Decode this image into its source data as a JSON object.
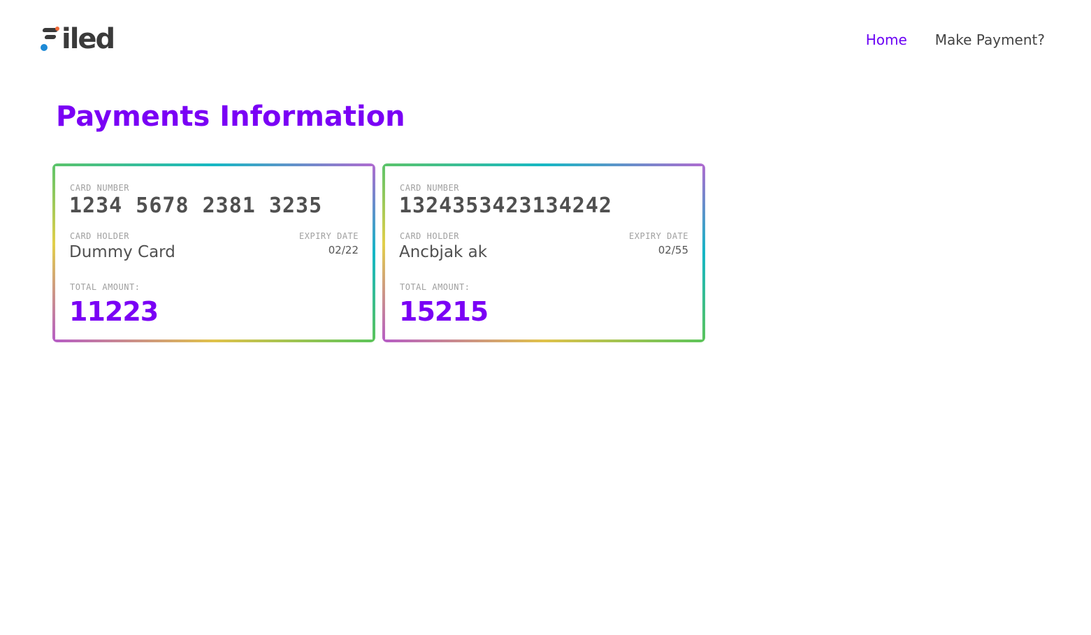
{
  "header": {
    "logo_text": "iled",
    "nav": {
      "home_label": "Home",
      "make_payment_label": "Make Payment?"
    }
  },
  "main": {
    "title": "Payments Information",
    "cards": [
      {
        "card_number_label": "CARD NUMBER",
        "card_number": "1234 5678 2381 3235",
        "card_holder_label": "CARD HOLDER",
        "card_holder": "Dummy Card",
        "expiry_label": "EXPIRY DATE",
        "expiry": "02/22",
        "total_label": "TOTAL AMOUNT:",
        "total": "11223"
      },
      {
        "card_number_label": "CARD NUMBER",
        "card_number": "1324353423134242",
        "card_holder_label": "CARD HOLDER",
        "card_holder": "Ancbjak ak",
        "expiry_label": "EXPIRY DATE",
        "expiry": "02/55",
        "total_label": "TOTAL AMOUNT:",
        "total": "15215"
      }
    ]
  },
  "colors": {
    "accent": "#7a00f5",
    "nav_active": "#6a00f4",
    "text": "#505050",
    "label": "#a0a0a0"
  },
  "icons": {
    "logo": "filed-logo-icon"
  }
}
